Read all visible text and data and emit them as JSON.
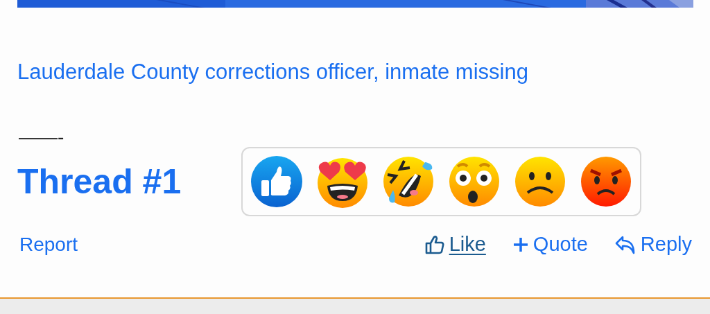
{
  "link": "Lauderdale County corrections officer, inmate missing",
  "separator": "——-",
  "heading": "Thread #1",
  "reactions": [
    {
      "kind": "like"
    },
    {
      "kind": "love"
    },
    {
      "kind": "haha"
    },
    {
      "kind": "wow"
    },
    {
      "kind": "sad"
    },
    {
      "kind": "angry"
    }
  ],
  "report": "Report",
  "actions": [
    {
      "kind": "like",
      "label": "Like"
    },
    {
      "kind": "quote",
      "label": "Quote"
    },
    {
      "kind": "reply",
      "label": "Reply"
    }
  ]
}
